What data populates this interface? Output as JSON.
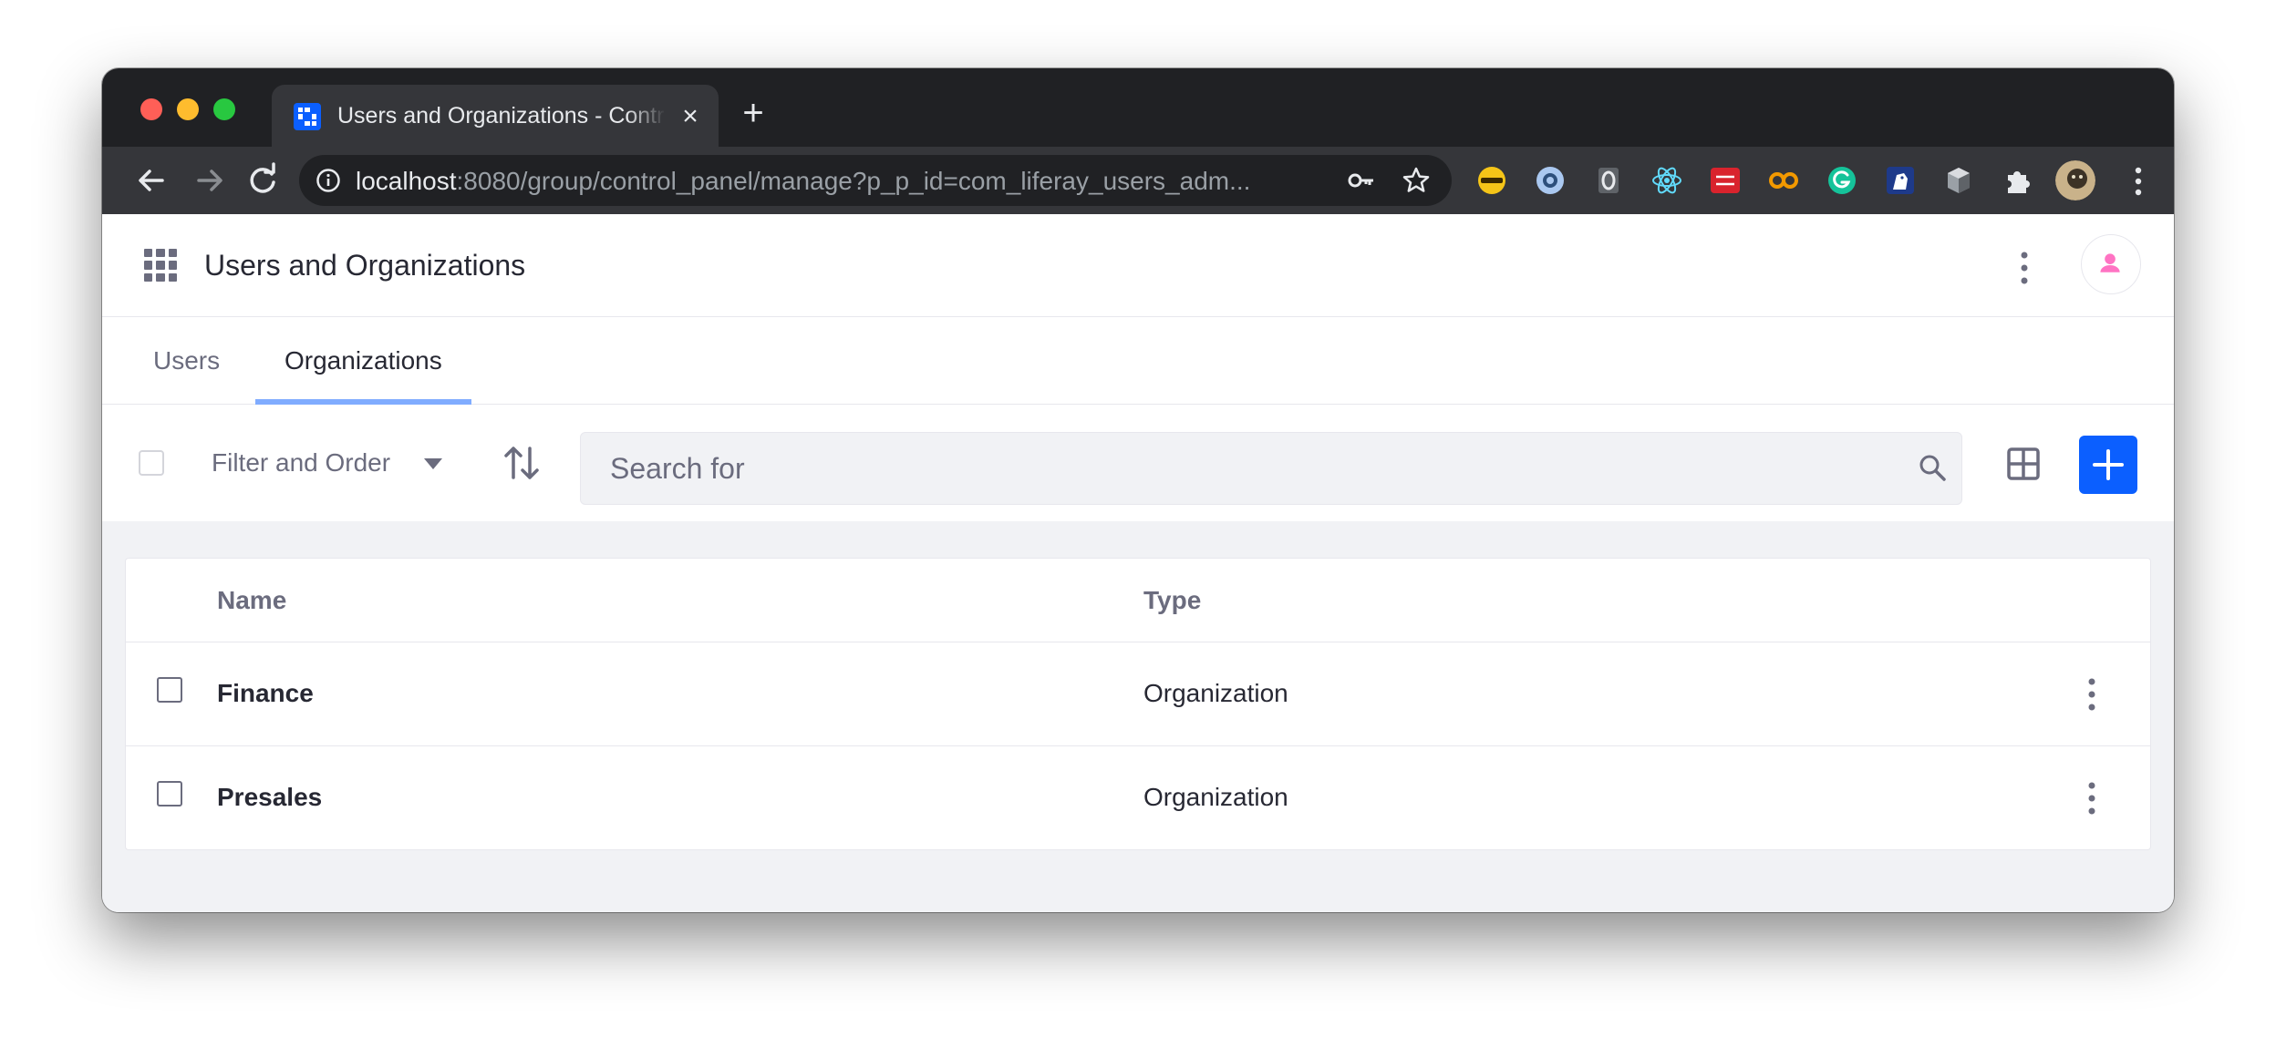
{
  "browser": {
    "tab_title": "Users and Organizations - Control Panel",
    "url_host": "localhost",
    "url_rest": ":8080/group/control_panel/manage?p_p_id=com_liferay_users_adm...",
    "extension_icons": [
      "key-extension-icon",
      "circle-extension-icon",
      "zero-extension-icon",
      "react-devtools-icon",
      "cors-extension-icon",
      "infinity-extension-icon",
      "grammarly-icon",
      "unicorn-extension-icon",
      "cube-extension-icon",
      "puzzle-extensions-icon",
      "profile-avatar-icon"
    ],
    "colors": {
      "frame": "#202124",
      "toolbar": "#35363a"
    }
  },
  "header": {
    "title": "Users and Organizations"
  },
  "tabs": [
    {
      "label": "Users",
      "active": false
    },
    {
      "label": "Organizations",
      "active": true
    }
  ],
  "management_bar": {
    "filter_label": "Filter and Order",
    "search_placeholder": "Search for"
  },
  "table": {
    "columns": [
      "Name",
      "Type"
    ],
    "rows": [
      {
        "name": "Finance",
        "type": "Organization"
      },
      {
        "name": "Presales",
        "type": "Organization"
      }
    ]
  },
  "colors": {
    "primary": "#0b5fff",
    "active_tab_indicator": "#80acff",
    "avatar": "#ff73c3"
  }
}
